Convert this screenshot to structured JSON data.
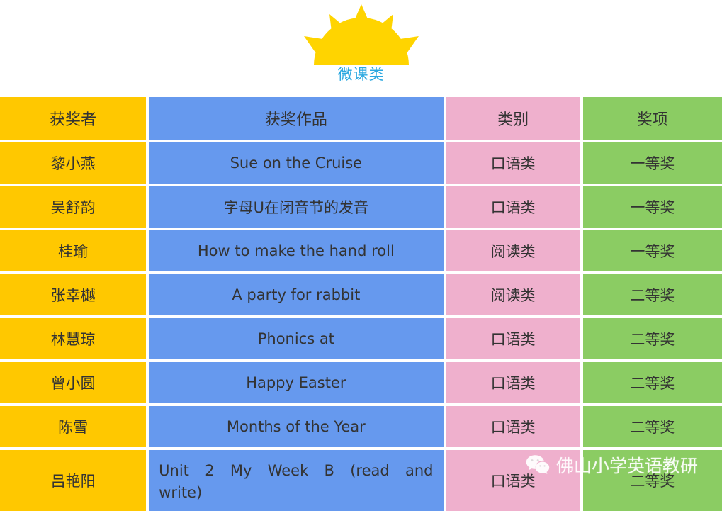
{
  "header": {
    "logo_icon": "sun-icon",
    "title": "微课类",
    "title_color": "#2BA8E0",
    "sun_color": "#FFD400",
    "sun_body_color": "#FFC800"
  },
  "table": {
    "columns": [
      {
        "key": "name",
        "label": "获奖者",
        "color": "#FFC800"
      },
      {
        "key": "work",
        "label": "获奖作品",
        "color": "#6699EE"
      },
      {
        "key": "cat",
        "label": "类别",
        "color": "#EFB0CD"
      },
      {
        "key": "award",
        "label": "奖项",
        "color": "#8BCC63"
      }
    ],
    "rows": [
      {
        "name": "黎小燕",
        "work": "Sue on the Cruise",
        "cat": "口语类",
        "award": "一等奖"
      },
      {
        "name": "吴舒韵",
        "work": "字母U在闭音节的发音",
        "cat": "口语类",
        "award": "一等奖"
      },
      {
        "name": "桂瑜",
        "work": "How to make the hand roll",
        "cat": "阅读类",
        "award": "一等奖"
      },
      {
        "name": "张幸樾",
        "work": "A party for rabbit",
        "cat": "阅读类",
        "award": "二等奖"
      },
      {
        "name": "林慧琼",
        "work": "Phonics at",
        "cat": "口语类",
        "award": "二等奖"
      },
      {
        "name": "曾小圆",
        "work": "Happy Easter",
        "cat": "口语类",
        "award": "二等奖"
      },
      {
        "name": "陈雪",
        "work": "Months of the Year",
        "cat": "口语类",
        "award": "二等奖"
      },
      {
        "name": "吕艳阳",
        "work_line1": "Unit 2 My Week B (read and",
        "work_line2": "write)",
        "cat": "口语类",
        "award": "二等奖"
      }
    ]
  },
  "watermark": {
    "icon": "wechat-icon",
    "text": "佛山小学英语教研"
  }
}
